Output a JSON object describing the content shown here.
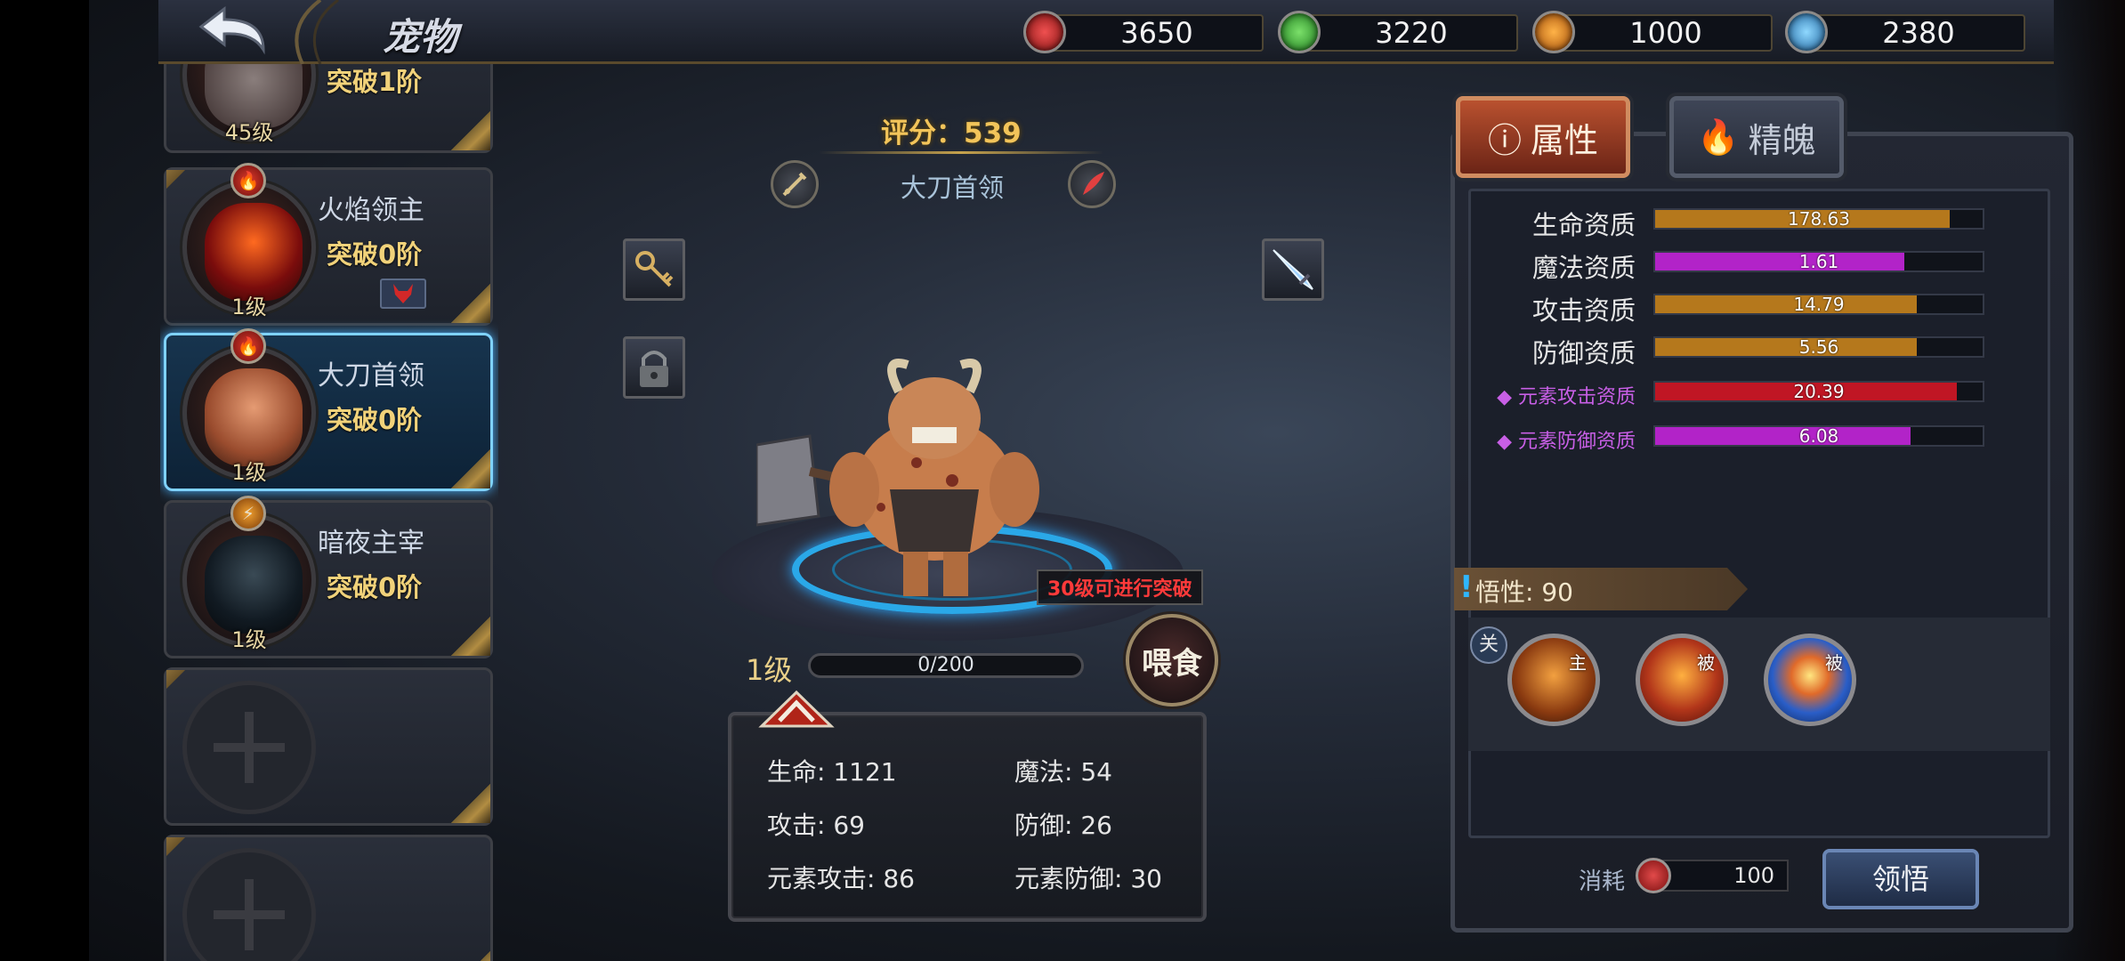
{
  "header": {
    "title": "宠物",
    "currencies": [
      {
        "icon": "red-gem-icon",
        "value": "3650",
        "color": "#d9322e"
      },
      {
        "icon": "green-gem-icon",
        "value": "3220",
        "color": "#3cbf3c"
      },
      {
        "icon": "orange-lightning-gem-icon",
        "value": "1000",
        "color": "#e28a22"
      },
      {
        "icon": "blue-snowflake-gem-icon",
        "value": "2380",
        "color": "#3aa7e6"
      }
    ]
  },
  "pet_list": {
    "items": [
      {
        "name": "",
        "break": "突破1阶",
        "level": "45级",
        "element": "fire"
      },
      {
        "name": "火焰领主",
        "break": "突破0阶",
        "level": "1级",
        "element": "fire"
      },
      {
        "name": "大刀首领",
        "break": "突破0阶",
        "level": "1级",
        "element": "fire",
        "selected": true
      },
      {
        "name": "暗夜主宰",
        "break": "突破0阶",
        "level": "1级",
        "element": "lightning"
      }
    ],
    "empty_slots": 2
  },
  "pet_detail": {
    "score_label": "评分：539",
    "name": "大刀首领",
    "breakthrough_tip": "30级可进行突破",
    "feed_label": "喂食",
    "level_label": "1级",
    "exp_text": "0/200",
    "stats": {
      "hp": "生命: 1121",
      "mp": "魔法: 54",
      "atk": "攻击: 69",
      "def": "防御: 26",
      "elem_atk": "元素攻击: 86",
      "elem_def": "元素防御: 30"
    }
  },
  "right_panel": {
    "tabs": [
      {
        "label": "属性",
        "icon": "info-icon",
        "active": true
      },
      {
        "label": "精魄",
        "icon": "flame-icon",
        "active": false
      }
    ],
    "attributes": [
      {
        "label": "生命资质",
        "value": "178.63",
        "fill": 0.9,
        "color": "#b5781c"
      },
      {
        "label": "魔法资质",
        "value": "1.61",
        "fill": 0.76,
        "color": "#b223c8"
      },
      {
        "label": "攻击资质",
        "value": "14.79",
        "fill": 0.8,
        "color": "#b5781c"
      },
      {
        "label": "防御资质",
        "value": "5.56",
        "fill": 0.8,
        "color": "#b5781c"
      },
      {
        "label": "元素攻击资质",
        "value": "20.39",
        "fill": 0.92,
        "color": "#c01624",
        "elemental": true
      },
      {
        "label": "元素防御资质",
        "value": "6.08",
        "fill": 0.78,
        "color": "#b223c8",
        "elemental": true
      }
    ],
    "wuxing_label": "悟性: 90",
    "close_tag": "关",
    "skills": [
      {
        "tag": "主",
        "icon": "fire-monk-skill-icon"
      },
      {
        "tag": "被",
        "icon": "flame-body-skill-icon"
      },
      {
        "tag": "被",
        "icon": "slash-skill-icon"
      }
    ],
    "cost_label": "消耗",
    "cost_value": "100",
    "comprehend_label": "领悟"
  }
}
